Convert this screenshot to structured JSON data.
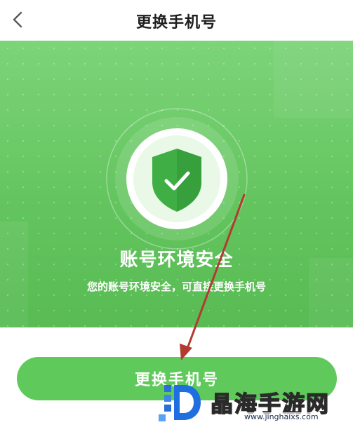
{
  "header": {
    "title": "更换手机号",
    "back_icon": "chevron-left-icon"
  },
  "hero": {
    "badge_icon": "shield-check-icon",
    "heading": "账号环境安全",
    "subtext": "您的账号环境安全，可直接更换手机号"
  },
  "actions": {
    "primary_label": "更换手机号"
  },
  "watermark": {
    "brand_text": "晶海手游网",
    "url_text": "www.jinghaixs.com"
  },
  "colors": {
    "accent_green": "#5fca5b",
    "hero_green": "#6cc867",
    "annotation_arrow": "#c0392b"
  }
}
